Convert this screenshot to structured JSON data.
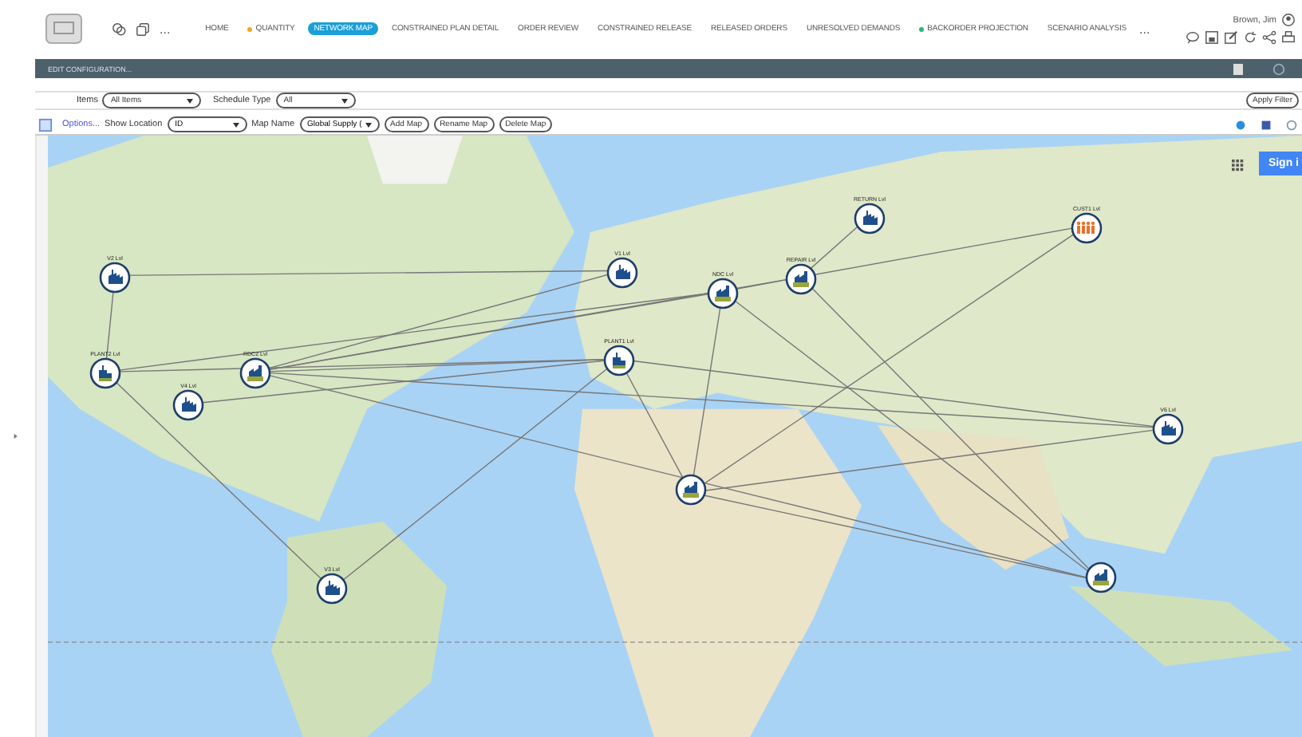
{
  "nav": {
    "items": [
      {
        "label": "HOME",
        "selected": false
      },
      {
        "label": "QUANTITY",
        "selected": false,
        "color": "#f5a623"
      },
      {
        "label": "NETWORK MAP",
        "selected": true
      },
      {
        "label": "CONSTRAINED PLAN DETAIL",
        "selected": false
      },
      {
        "label": "ORDER REVIEW",
        "selected": false
      },
      {
        "label": "CONSTRAINED RELEASE",
        "selected": false
      },
      {
        "label": "RELEASED ORDERS",
        "selected": false
      },
      {
        "label": "UNRESOLVED DEMANDS",
        "selected": false
      },
      {
        "label": "BACKORDER PROJECTION",
        "selected": false,
        "color": "#2bb673"
      },
      {
        "label": "SCENARIO ANALYSIS",
        "selected": false
      }
    ],
    "more": "...",
    "overflow": "..."
  },
  "user": {
    "name": "Brown, Jim"
  },
  "config_bar": {
    "label": "EDIT CONFIGURATION..."
  },
  "filters": {
    "items_label": "Items",
    "items_value": "All Items",
    "schedule_label": "Schedule Type",
    "schedule_value": "All",
    "apply": "Apply Filter"
  },
  "map_toolbar": {
    "options": "Options...",
    "location_label": "Show Location",
    "location_value": "ID",
    "map_label": "Map Name",
    "map_value": "Global Supply (",
    "buttons": [
      "Add Map",
      "Rename Map",
      "Delete Map"
    ]
  },
  "map": {
    "sign_in": "Sign i",
    "nodes": [
      {
        "label": "V2 Lvl",
        "kind": "factory"
      },
      {
        "label": "PLANT2 Lvl",
        "kind": "plant"
      },
      {
        "label": "V4 Lvl",
        "kind": "factory"
      },
      {
        "label": "RDC2 Lvl",
        "kind": "warehouse"
      },
      {
        "label": "V1 Lvl",
        "kind": "factory"
      },
      {
        "label": "PLANT1 Lvl",
        "kind": "plant"
      },
      {
        "label": "NDC Lvl",
        "kind": "warehouse"
      },
      {
        "label": "REPAIR Lvl",
        "kind": "warehouse"
      },
      {
        "label": "RETURN Lvl",
        "kind": "factory"
      },
      {
        "label": "CUST1 Lvl",
        "kind": "customer"
      },
      {
        "label": "V6 Lvl",
        "kind": "factory"
      },
      {
        "kind": "warehouse"
      },
      {
        "kind": "warehouse"
      },
      {
        "label": "V3 Lvl",
        "kind": "factory"
      }
    ]
  }
}
